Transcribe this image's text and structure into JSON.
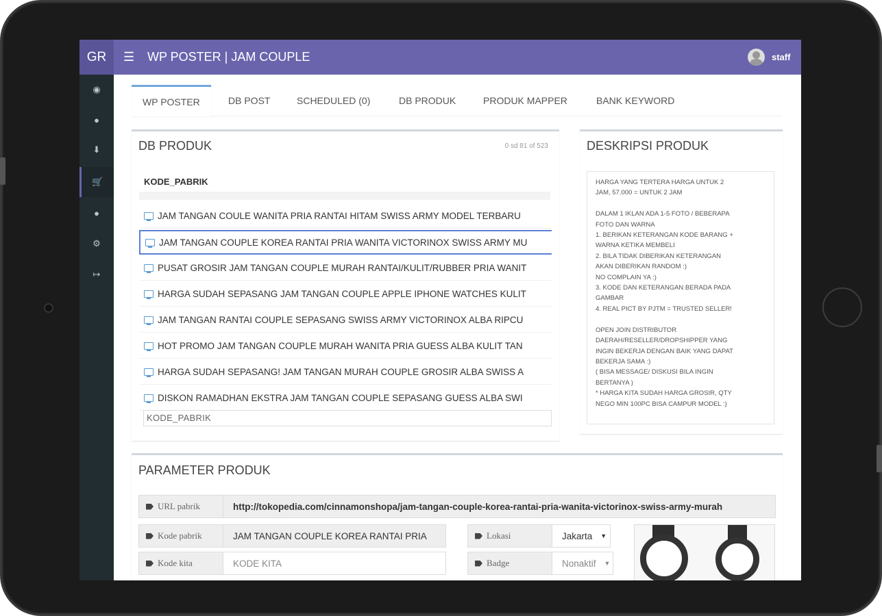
{
  "app": {
    "brand": "GR",
    "title": "WP POSTER | JAM COUPLE",
    "user": "staff",
    "accent": "#6a64ad"
  },
  "sidebar": {
    "items": [
      "dashboard-icon",
      "user-icon",
      "download-icon",
      "cart-icon",
      "user-icon",
      "share-icon",
      "logout-icon"
    ],
    "active_index": 3
  },
  "tabs": [
    {
      "label": "WP POSTER",
      "active": true
    },
    {
      "label": "DB POST"
    },
    {
      "label": "SCHEDULED (0)"
    },
    {
      "label": "DB PRODUK"
    },
    {
      "label": "PRODUK MAPPER"
    },
    {
      "label": "BANK KEYWORD"
    }
  ],
  "db_produk": {
    "title": "DB PRODUK",
    "count": "0 sd 81 of 523",
    "column": "KODE_PABRIK",
    "rows": [
      "JAM TANGAN COULE WANITA PRIA RANTAI HITAM SWISS ARMY MODEL TERBARU",
      "JAM TANGAN COUPLE KOREA RANTAI PRIA WANITA VICTORINOX SWISS ARMY MU",
      "PUSAT GROSIR JAM TANGAN COUPLE MURAH RANTAI/KULIT/RUBBER PRIA WANIT",
      "HARGA SUDAH SEPASANG JAM TANGAN COUPLE APPLE IPHONE WATCHES KULIT",
      "JAM TANGAN RANTAI COUPLE SEPASANG SWISS ARMY VICTORINOX ALBA RIPCU",
      "HOT PROMO JAM TANGAN COUPLE MURAH WANITA PRIA GUESS ALBA KULIT TAN",
      "HARGA SUDAH SEPASANG! JAM TANGAN MURAH COUPLE GROSIR ALBA SWISS A",
      "DISKON RAMADHAN EKSTRA JAM TANGAN COUPLE SEPASANG GUESS ALBA SWI"
    ],
    "selected_index": 1,
    "footer_input": "KODE_PABRIK"
  },
  "deskripsi": {
    "title": "DESKRIPSI PRODUK",
    "text": "HARGA YANG TERTERA HARGA UNTUK 2\nJAM, 57.000 = UNTUK 2 JAM\n\nDALAM 1 IKLAN ADA 1-5 FOTO / BEBERAPA\nFOTO DAN WARNA\n1. BERIKAN KETERANGAN KODE BARANG +\nWARNA KETIKA MEMBELI\n2. BILA TIDAK DIBERIKAN KETERANGAN\nAKAN DIBERIKAN RANDOM :)\nNO COMPLAIN YA :)\n3. KODE DAN KETERANGAN BERADA PADA\nGAMBAR\n4. REAL PICT BY PJTM = TRUSTED SELLER!\n\nOPEN JOIN DISTRIBUTOR\nDAERAH/RESELLER/DROPSHIPPER YANG\nINGIN BEKERJA DENGAN BAIK YANG DAPAT\nBEKERJA SAMA :)\n( BISA MESSAGE/ DISKUSI BILA INGIN\nBERTANYA )\n* HARGA KITA SUDAH HARGA GROSIR, QTY\nNEGO MIN 100PC BISA CAMPUR MODEL :)"
  },
  "parameter": {
    "title": "PARAMETER PRODUK",
    "url_label": "URL pabrik",
    "url_value": "http://tokopedia.com/cinnamonshopa/jam-tangan-couple-korea-rantai-pria-wanita-victorinox-swiss-army-murah",
    "kode_pabrik_label": "Kode pabrik",
    "kode_pabrik_value": "JAM TANGAN COUPLE KOREA RANTAI PRIA",
    "kode_kita_label": "Kode kita",
    "kode_kita_placeholder": "KODE KITA",
    "lokasi_label": "Lokasi",
    "lokasi_value": "Jakarta",
    "badge_label": "Badge",
    "badge_value": "Nonaktif"
  }
}
